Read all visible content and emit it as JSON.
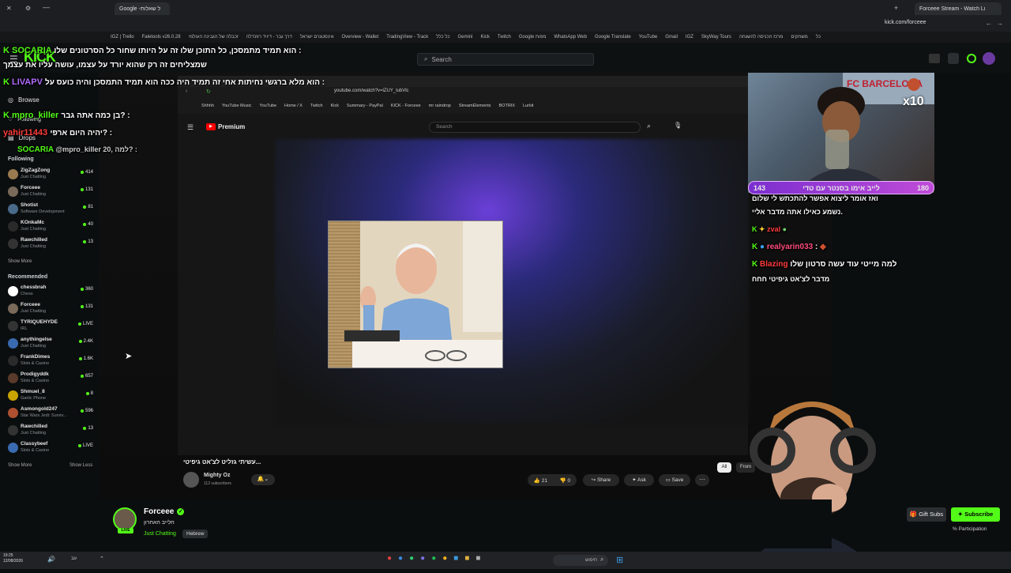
{
  "browser": {
    "tab_left": "Google -ל שאלות",
    "tab_right": "Forceee Stream - Watch Li",
    "url": "kick.com/forceee",
    "bookmarks": [
      "IGZ | Trello",
      "Faletools v26.0.28",
      "זכבלה של הגבינה העולמי",
      "דרך גבר - דיויד רוזנדלה",
      "אינסטגרם ישראל",
      "Overview - Wallet",
      "TradingView - Track",
      "כל כלל",
      "Gemini",
      "Kick",
      "Twitch",
      "Google מפות",
      "WhatsApp Web",
      "Google Translate",
      "YouTube",
      "Gmail",
      "IGZ",
      "SkyWay Tours",
      "מרכז הכניסה להשגחה",
      "משחקים",
      "כל"
    ]
  },
  "kick": {
    "search_placeholder": "Search",
    "nav": {
      "browse": "Browse",
      "following": "Following",
      "drops": "Drops"
    }
  },
  "sidebar": {
    "following_title": "Following",
    "following": [
      {
        "name": "ZigZagZong",
        "category": "Just Chatting",
        "viewers": "414",
        "color": "#9a7b4f"
      },
      {
        "name": "Forceee",
        "category": "Just Chatting",
        "viewers": "131",
        "color": "#7a6a5a"
      },
      {
        "name": "Shotist",
        "category": "Software Development",
        "viewers": "81",
        "color": "#4a6a8a"
      },
      {
        "name": "KOnkaMc",
        "category": "Just Chatting",
        "viewers": "40",
        "color": "#2a2a2a"
      },
      {
        "name": "Rawchilled",
        "category": "Just Chatting",
        "viewers": "13",
        "color": "#333333"
      }
    ],
    "show_more_1": "Show More",
    "recommended_title": "Recommended",
    "recommended": [
      {
        "name": "chessbrah",
        "category": "Chess",
        "viewers": "360",
        "color": "#ffffff"
      },
      {
        "name": "Forceee",
        "category": "Just Chatting",
        "viewers": "131",
        "color": "#7a6a5a"
      },
      {
        "name": "TYRIQUEHYDE",
        "category": "IRL",
        "viewers": "LIVE",
        "color": "#333333"
      },
      {
        "name": "anythingelse",
        "category": "Just Chatting",
        "viewers": "2.4K",
        "color": "#3a6ab0"
      },
      {
        "name": "FrankDimes",
        "category": "Slots & Casino",
        "viewers": "1.6K",
        "color": "#2a2a2a"
      },
      {
        "name": "Prodigyddk",
        "category": "Slots & Casino",
        "viewers": "657",
        "color": "#5a3a2a"
      },
      {
        "name": "Shmuel_8",
        "category": "Gartic Phone",
        "viewers": "8",
        "color": "#c9a400"
      },
      {
        "name": "Asmongold247",
        "category": "Star Wars Jedi: Surviv...",
        "viewers": "596",
        "color": "#b05030"
      },
      {
        "name": "Rawchilled",
        "category": "Just Chatting",
        "viewers": "13",
        "color": "#333333"
      },
      {
        "name": "Classybeef",
        "category": "Slots & Casino",
        "viewers": "LIVE",
        "color": "#3a6ab0"
      }
    ],
    "show_more_2": "Show More",
    "show_less": "Show Less"
  },
  "chat_overlay": [
    {
      "user": "SOCARIA",
      "msg": "הוא תמיד מתמסכן, כל התוכן שלו זה על היותו שחור כל הסרטונים שלו :"
    },
    {
      "user": "",
      "msg": "שמצליחים זה רק שהוא יורד על עצמו, עושה עליו את עצמך"
    },
    {
      "user": "LIVAPV",
      "msg": "הוא מלא ברגשי נחיתות אחי זה תמיד היה ככה הוא תמיד התמסכן והיה כועס על :"
    },
    {
      "user": "mpro_killer",
      "msg": "בן כמה אתה גבר? :"
    },
    {
      "user": "yahir11443",
      "msg": "יהיה היום ארפי? :"
    },
    {
      "user": "SOCARIA",
      "msg": "@mpro_killer 20, למה? :"
    }
  ],
  "youtube": {
    "url": "youtube.com/watch?v=lZUY_lubVlc",
    "bookmarks": [
      "Shhhh",
      "YouTube Music",
      "YouTube",
      "Home / X",
      "Twitch",
      "Kick",
      "Summary - PayPal",
      "KICK - Forceee",
      "mr raindrop",
      "StreamElements",
      "BOTRIX",
      "Lurkit"
    ],
    "logo": "Premium",
    "search_placeholder": "Search",
    "video_title": "עשיתי גזליט לצ'אט גיפיטי...",
    "channel": "Mighty Oz",
    "subscribers": "112 subscribers",
    "likes": "21",
    "dislikes": "0",
    "share": "Share",
    "ask": "Ask",
    "save": "Save",
    "chip_all": "All",
    "chip_from": "From"
  },
  "cam": {
    "goal_left": "143",
    "goal_text": "לייב אימו בסנטר עם טדי",
    "goal_right": "180",
    "multiplier": "x10",
    "shirt_text": "FC BARCELONA"
  },
  "stream_chat": [
    {
      "user": "",
      "msg": "ואז אומר ליצוא אפשר להתכתש לי שלום"
    },
    {
      "user": "",
      "msg": "נשמע כאילו אתה מדבר אליי."
    },
    {
      "user": "zval",
      "msg": ""
    },
    {
      "user": "realyarin033",
      "msg": ""
    },
    {
      "user": "Blazing",
      "msg": "למה מייטי עוד עשה סרטון שלו"
    },
    {
      "user": "",
      "msg": "מדבר לצ'אט גיפיטי חחח"
    }
  ],
  "channel_info": {
    "name": "Forceee",
    "subtitle": "חלייב האחרון",
    "category": "Just Chatting",
    "tag": "Hebrew",
    "gift_subs": "Gift Subs",
    "subscribe": "Subscribe",
    "participation": "% Participation"
  },
  "taskbar": {
    "time": "19:25",
    "date": "12/08/2026",
    "search": "חיפוש",
    "lang": "עב"
  },
  "colors": {
    "kick_green": "#53fc18",
    "purple": "#9146ff"
  }
}
